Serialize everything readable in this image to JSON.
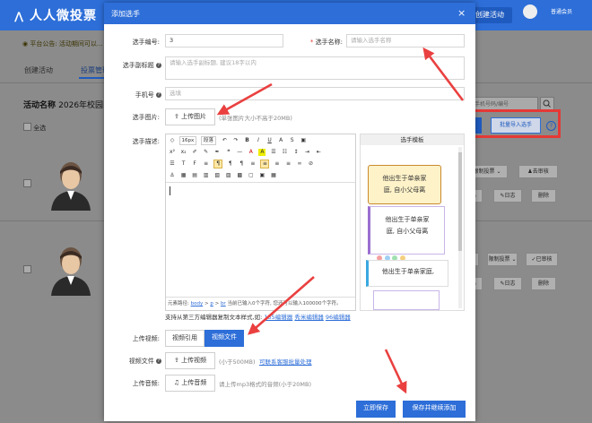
{
  "background": {
    "logo": "人人微投票",
    "header_button": "创建活动",
    "user_label": "普通会员",
    "notice": "平台公告: 活动期间可以...",
    "tabs": [
      "创建活动",
      "投票管理"
    ],
    "activity_name_label": "活动名称",
    "activity_name_value": "2026年校园...",
    "select_all": "全选",
    "search_placeholder": "手机号码/编号",
    "add_button": "+",
    "batch_import": "批量导入选手",
    "help": "?",
    "row1": {
      "limit_vote": "限制投票",
      "reject": "去审核",
      "log": "日志",
      "delete": "删除"
    },
    "row2": {
      "limit_vote": "限制投票",
      "approved": "已审核",
      "log": "日志",
      "delete": "删除"
    }
  },
  "modal": {
    "title": "添加选手",
    "close": "×",
    "fields": {
      "number_label": "选手编号:",
      "number_value": "3",
      "name_label": "选手名称:",
      "name_placeholder": "请输入选手名称",
      "subtitle_label": "选手副标题",
      "subtitle_placeholder": "请输入选手副标题, 建议18字以内",
      "phone_label": "手机号",
      "phone_placeholder": "选填",
      "image_label": "选手图片:",
      "image_button": "上传图片",
      "image_hint": "(单张图片大小不高于20MB)",
      "desc_label": "选手描述:",
      "video_label": "上传视频:",
      "video_opt_ref": "视频引用",
      "video_opt_file": "视频文件",
      "video_file_label": "视频文件",
      "video_button": "上传视频",
      "video_hint": "(小于500MB)",
      "video_link": "可联系客服批量处理",
      "audio_label": "上传音频:",
      "audio_button": "上传音频",
      "audio_hint": "请上传mp3格式的音频(小于20MB)"
    },
    "editor": {
      "font_size": "16px",
      "paragraph": "段落",
      "status_prefix": "元素路径:",
      "status_path": [
        "body",
        "p",
        "br"
      ],
      "status_count": "当前已输入0个字符, 您还可以输入100000个字符。",
      "support_text": "支持从第三方编辑器复制文本样式,如:",
      "support_links": [
        "135编辑器",
        "秀米编辑器",
        "96编辑器"
      ]
    },
    "templates": {
      "title": "选手模板",
      "card1_lines": [
        "他出生于单亲家",
        "庭, 自小父母离"
      ],
      "card2_lines": [
        "他出生于单亲家",
        "庭, 自小父母离"
      ],
      "card3_lines": [
        "他出生于单亲家庭,"
      ]
    },
    "buttons": {
      "save": "立即保存",
      "save_continue": "保存并继续添加"
    }
  },
  "colors": {
    "brand_blue": "#2d6ed8",
    "annotation_red": "#e53935"
  }
}
